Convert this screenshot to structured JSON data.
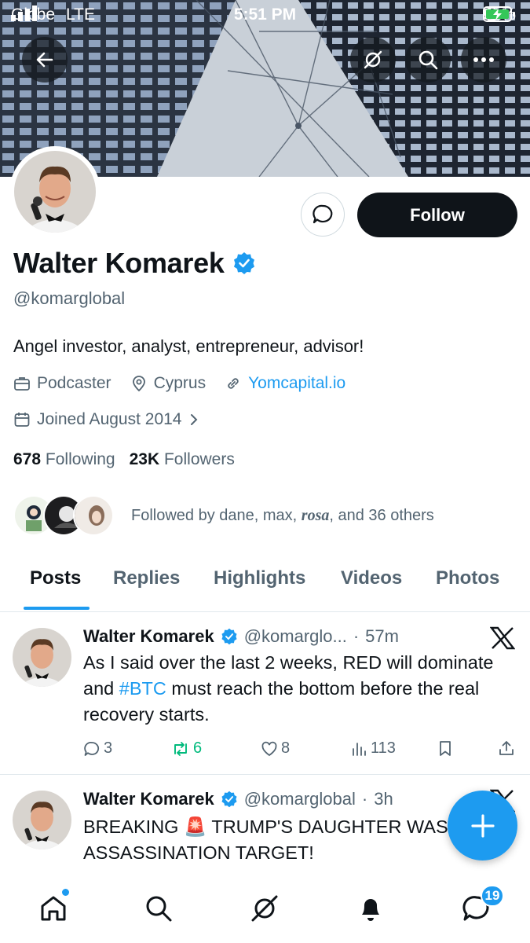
{
  "status_bar": {
    "carrier": "Globe",
    "network": "LTE",
    "time": "5:51 PM",
    "battery": "91%"
  },
  "profile": {
    "name": "Walter Komarek",
    "handle": "@komarglobal",
    "bio": "Angel investor, analyst, entrepreneur, advisor!",
    "category": "Podcaster",
    "location": "Cyprus",
    "website": "Yomcapital.io",
    "joined": "Joined August 2014",
    "following_count": "678",
    "following_label": "Following",
    "followers_count": "23K",
    "followers_label": "Followers",
    "followed_by_prefix": "Followed by dane, max, ",
    "followed_by_rosa": "rosa",
    "followed_by_suffix": ", and 36 others",
    "follow_label": "Follow"
  },
  "tabs": [
    "Posts",
    "Replies",
    "Highlights",
    "Videos",
    "Photos"
  ],
  "posts": [
    {
      "name": "Walter Komarek",
      "handle": "@komarglo...",
      "time": "57m",
      "text_1": "As I said over the last 2 weeks,  RED will dominate and ",
      "hashtag": "#BTC",
      "text_2": " must reach the bottom before the real recovery starts.",
      "replies": "3",
      "reposts": "6",
      "likes": "8",
      "views": "113"
    },
    {
      "name": "Walter Komarek",
      "handle": "@komarglobal",
      "time": "3h",
      "text_1": "BREAKING ",
      "emoji": "🚨",
      "text_2": " TRUMP'S DAUGHTER WAS ASSASSINATION TARGET!"
    }
  ],
  "nav": {
    "messages_badge": "19"
  },
  "colors": {
    "accent": "#1d9bf0",
    "text": "#0f1419",
    "muted": "#536471",
    "repost_active": "#00ba7c"
  }
}
